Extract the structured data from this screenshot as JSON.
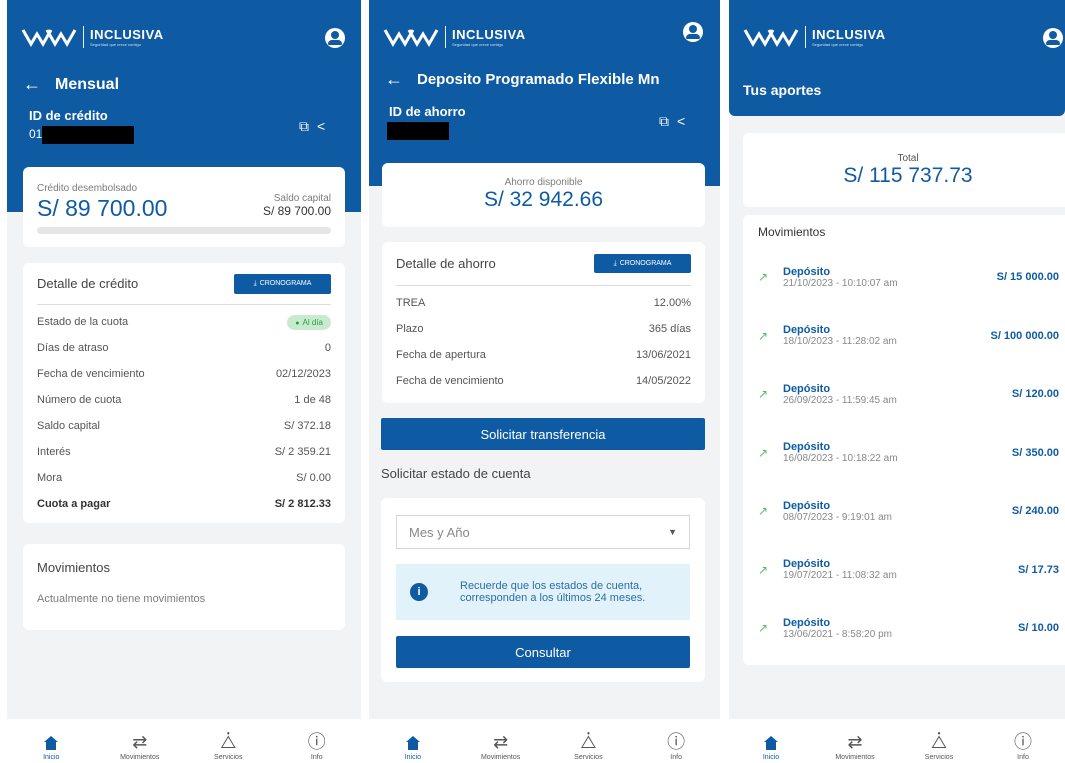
{
  "brand": {
    "name": "INCLUSIVA",
    "tagline": "Seguridad que crece contigo"
  },
  "tabs": [
    {
      "label": "Inicio",
      "icon": "home-icon"
    },
    {
      "label": "Movimientos",
      "icon": "transfer-icon"
    },
    {
      "label": "Servicios",
      "icon": "services-icon"
    },
    {
      "label": "Info",
      "icon": "info-icon"
    }
  ],
  "credit": {
    "title": "Mensual",
    "id_label": "ID de crédito",
    "id_prefix": "01",
    "disbursed_label": "Crédito desembolsado",
    "disbursed_value": "S/ 89 700.00",
    "balance_label": "Saldo capital",
    "balance_value": "S/ 89 700.00",
    "progress": 0,
    "detail_title": "Detalle de crédito",
    "cron_label": "CRONOGRAMA",
    "status_label": "Estado de la cuota",
    "status_value": "Al día",
    "rows": [
      {
        "label": "Días de atraso",
        "value": "0"
      },
      {
        "label": "Fecha de vencimiento",
        "value": "02/12/2023"
      },
      {
        "label": "Número de cuota",
        "value": "1 de 48"
      },
      {
        "label": "Saldo capital",
        "value": "S/ 372.18"
      },
      {
        "label": "Interés",
        "value": "S/ 2 359.21"
      },
      {
        "label": "Mora",
        "value": "S/ 0.00"
      },
      {
        "label": "Cuota a pagar",
        "value": "S/ 2 812.33"
      }
    ],
    "mov_title": "Movimientos",
    "mov_empty": "Actualmente no tiene movimientos"
  },
  "savings": {
    "title": "Deposito Programado Flexible Mn",
    "id_label": "ID de ahorro",
    "available_label": "Ahorro disponible",
    "available_value": "S/ 32 942.66",
    "detail_title": "Detalle de ahorro",
    "cron_label": "CRONOGRAMA",
    "rows": [
      {
        "label": "TREA",
        "value": "12.00%"
      },
      {
        "label": "Plazo",
        "value": "365 días"
      },
      {
        "label": "Fecha de apertura",
        "value": "13/06/2021"
      },
      {
        "label": "Fecha de vencimiento",
        "value": "14/05/2022"
      }
    ],
    "transfer_button": "Solicitar transferencia",
    "statement_title": "Solicitar estado de cuenta",
    "month_placeholder": "Mes y Año",
    "info_text": "Recuerde que los estados de cuenta, corresponden a los últimos 24 meses.",
    "consult_button": "Consultar"
  },
  "contributions": {
    "title": "Tus aportes",
    "total_label": "Total",
    "total_value": "S/ 115 737.73",
    "mov_title": "Movimientos",
    "items": [
      {
        "type": "Depósito",
        "date": "21/10/2023 - 10:10:07 am",
        "amount": "S/ 15 000.00"
      },
      {
        "type": "Depósito",
        "date": "18/10/2023 - 11:28:02 am",
        "amount": "S/ 100 000.00"
      },
      {
        "type": "Depósito",
        "date": "26/09/2023 - 11:59:45 am",
        "amount": "S/ 120.00"
      },
      {
        "type": "Depósito",
        "date": "16/08/2023 - 10:18:22 am",
        "amount": "S/ 350.00"
      },
      {
        "type": "Depósito",
        "date": "08/07/2023 - 9:19:01 am",
        "amount": "S/ 240.00"
      },
      {
        "type": "Depósito",
        "date": "19/07/2021 - 11:08:32 am",
        "amount": "S/ 17.73"
      },
      {
        "type": "Depósito",
        "date": "13/06/2021 - 8:58:20 pm",
        "amount": "S/ 10.00"
      }
    ]
  }
}
